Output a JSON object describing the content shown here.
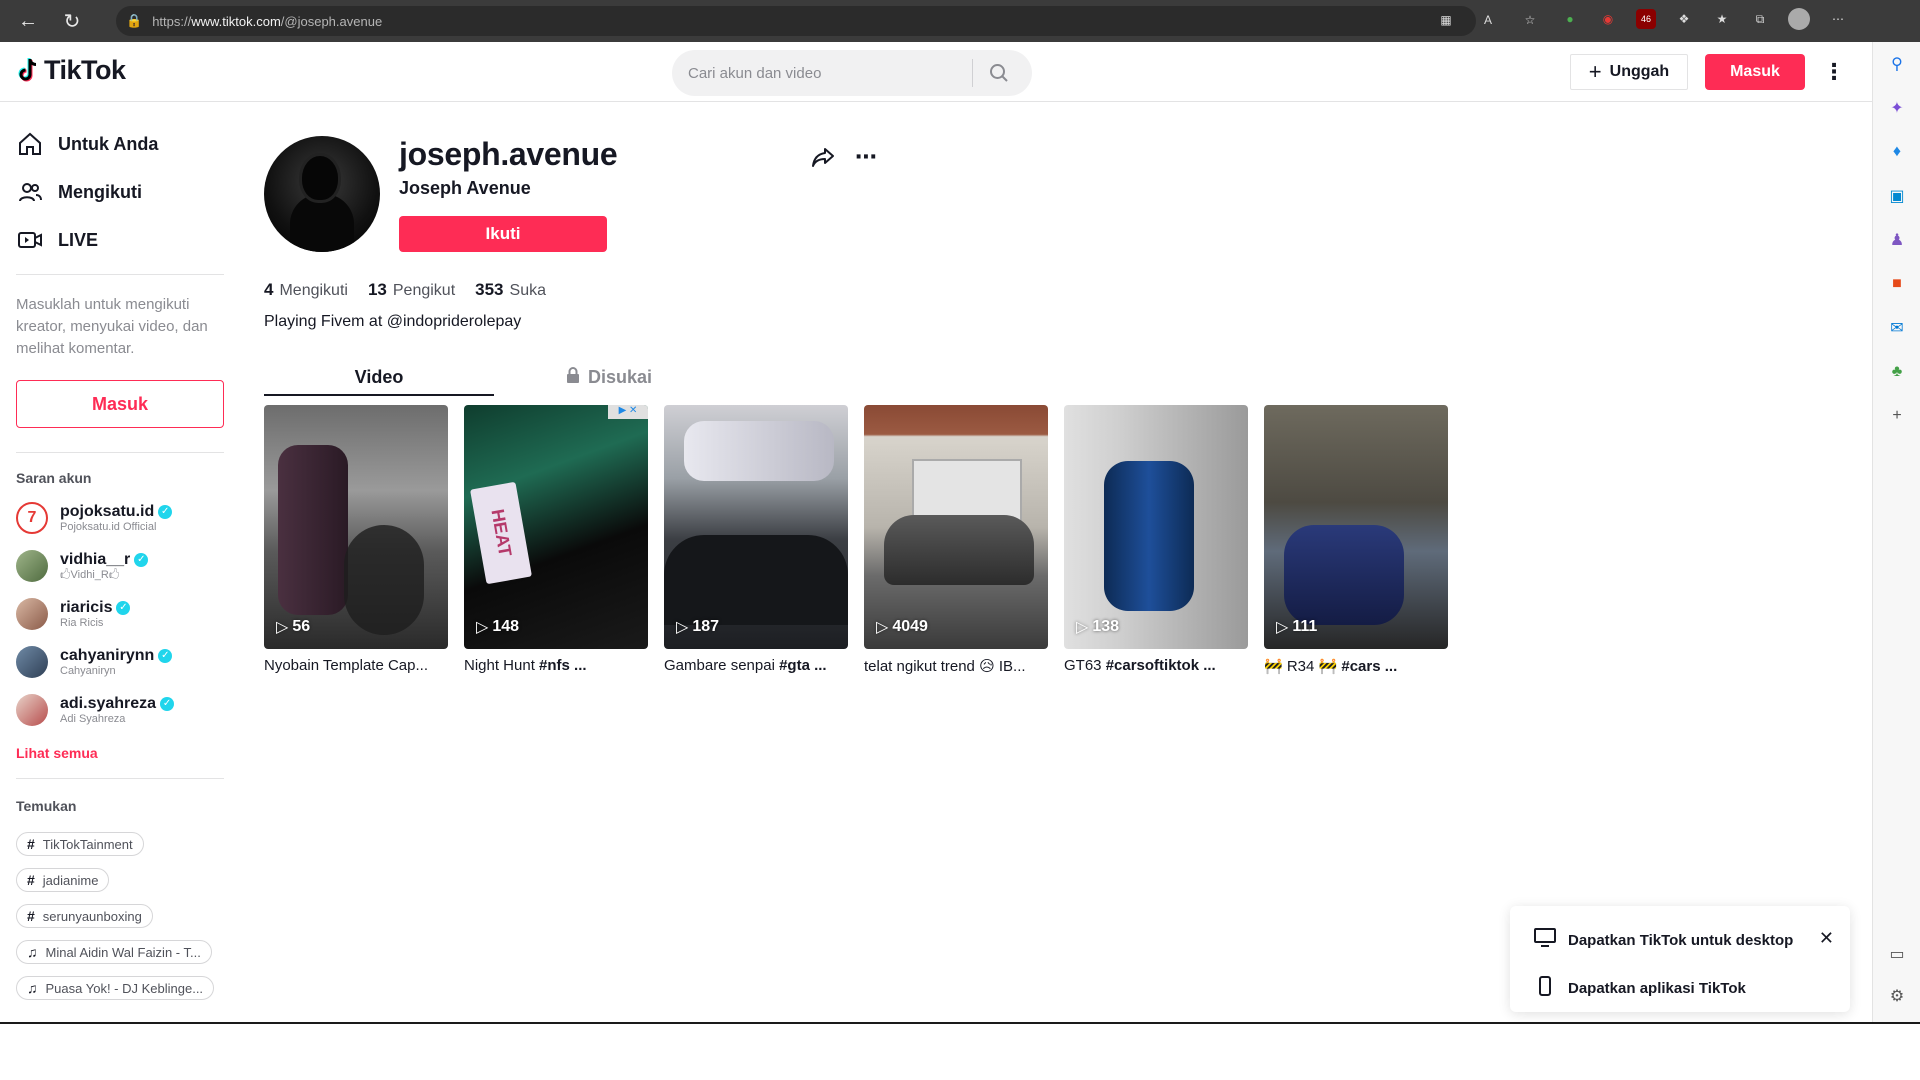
{
  "browser": {
    "url_prefix": "https://",
    "url_host": "www.tiktok.com",
    "url_path": "/@joseph.avenue",
    "ext_badge": "46"
  },
  "header": {
    "logo_text": "TikTok",
    "search_placeholder": "Cari akun dan video",
    "upload_label": "Unggah",
    "login_label": "Masuk"
  },
  "nav": {
    "items": [
      {
        "label": "Untuk Anda",
        "icon": "home-icon"
      },
      {
        "label": "Mengikuti",
        "icon": "users-icon"
      },
      {
        "label": "LIVE",
        "icon": "live-icon"
      }
    ],
    "login_prompt": "Masuklah untuk mengikuti kreator, menyukai video, dan melihat komentar.",
    "login_button": "Masuk",
    "suggested_title": "Saran akun",
    "suggested": [
      {
        "name": "pojoksatu.id",
        "sub": "Pojoksatu.id Official"
      },
      {
        "name": "vidhia__r",
        "sub": "🖒Vidhi_R🖒"
      },
      {
        "name": "riaricis",
        "sub": "Ria Ricis"
      },
      {
        "name": "cahyanirynn",
        "sub": "Cahyaniryn"
      },
      {
        "name": "adi.syahreza",
        "sub": "Adi Syahreza"
      }
    ],
    "see_all": "Lihat semua",
    "discover_title": "Temukan",
    "discover": [
      {
        "label": "TikTokTainment",
        "type": "hashtag"
      },
      {
        "label": "jadianime",
        "type": "hashtag"
      },
      {
        "label": "serunyaunboxing",
        "type": "hashtag"
      },
      {
        "label": "Minal Aidin Wal Faizin - T...",
        "type": "music"
      },
      {
        "label": "Puasa Yok! - DJ Keblinge...",
        "type": "music"
      }
    ]
  },
  "profile": {
    "username": "joseph.avenue",
    "display_name": "Joseph Avenue",
    "follow_label": "Ikuti",
    "stats": [
      {
        "value": "4",
        "label": "Mengikuti"
      },
      {
        "value": "13",
        "label": "Pengikut"
      },
      {
        "value": "353",
        "label": "Suka"
      }
    ],
    "bio": "Playing Fivem at @indopriderolepay",
    "tabs": [
      {
        "label": "Video",
        "active": true
      },
      {
        "label": "Disukai",
        "active": false
      }
    ]
  },
  "videos": [
    {
      "views": "56",
      "caption_plain": "Nyobain Template Cap...",
      "caption_bold": ""
    },
    {
      "views": "148",
      "caption_plain": "Night Hunt ",
      "caption_bold": "#nfs ..."
    },
    {
      "views": "187",
      "caption_plain": "Gambare senpai ",
      "caption_bold": "#gta ..."
    },
    {
      "views": "4049",
      "caption_plain": "telat ngikut trend 😥 IB...",
      "caption_bold": ""
    },
    {
      "views": "138",
      "caption_plain": "GT63 ",
      "caption_bold": "#carsoftiktok ..."
    },
    {
      "views": "111",
      "caption_plain": "🚧 R34 🚧 ",
      "caption_bold": "#cars ..."
    }
  ],
  "promo": {
    "desktop_label": "Dapatkan TikTok untuk desktop",
    "app_label": "Dapatkan aplikasi TikTok"
  },
  "colors": {
    "brand": "#fe2c55",
    "verified": "#20d5ec"
  }
}
